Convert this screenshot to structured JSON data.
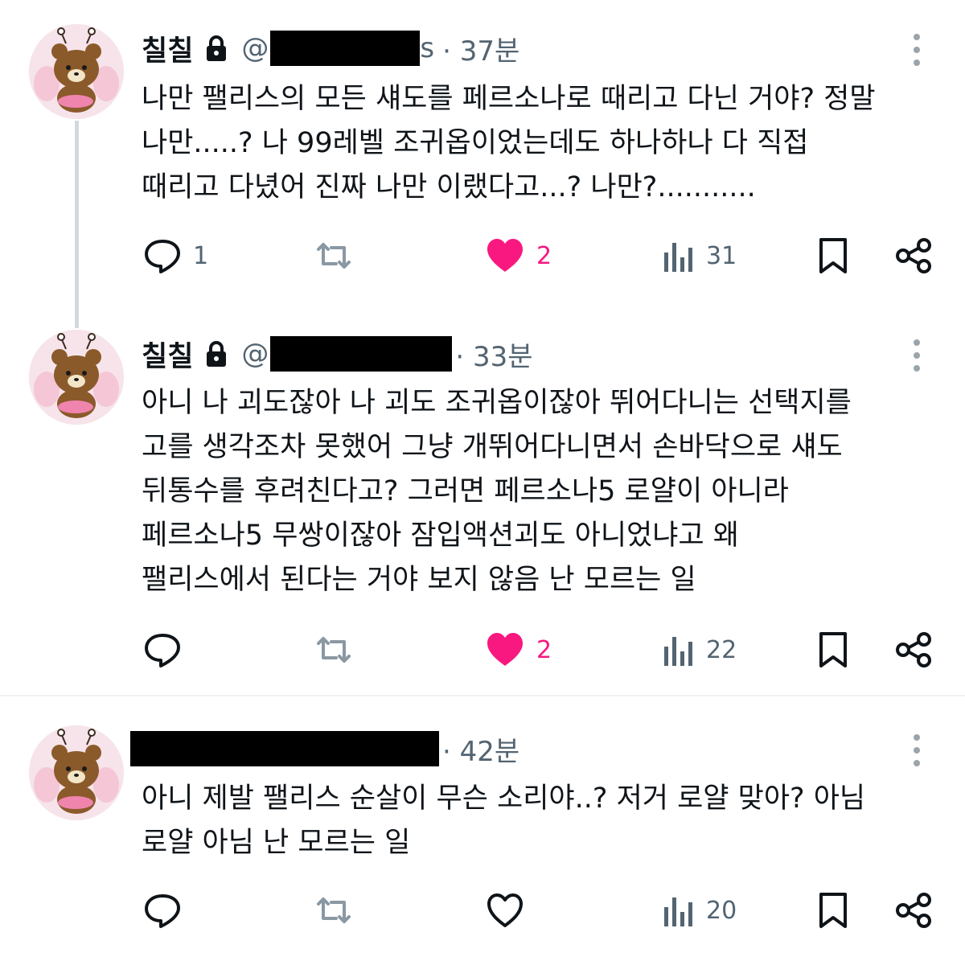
{
  "colors": {
    "like": "#f91880",
    "secondary": "#536471",
    "primary": "#0f1419"
  },
  "tweets": [
    {
      "name": "칠칠",
      "locked": true,
      "handle_prefix": "@",
      "handle_visible_tail": "s",
      "time": "· 37분",
      "lines": [
        "나만 팰리스의 모든 섀도를 페르소나로 때리고 다닌 거야? 정말",
        "나만.....? 나 99레벨 조귀옵이었는데도 하나하나 다 직접",
        "때리고 다녔어 진짜 나만 이랬다고...? 나만?..........."
      ],
      "replies": "1",
      "reposts": "",
      "likes": "2",
      "liked": true,
      "views": "31"
    },
    {
      "name": "칠칠",
      "locked": true,
      "handle_prefix": "@",
      "handle_visible_tail": "",
      "time": "· 33분",
      "lines": [
        "아니 나 괴도잖아 나 괴도 조귀옵이잖아 뛰어다니는 선택지를",
        "고를 생각조차 못했어 그냥 개뛰어다니면서 손바닥으로 섀도",
        "뒤통수를 후려친다고? 그러면 페르소나5 로얄이 아니라",
        "페르소나5 무쌍이잖아 잠입액션괴도 아니었냐고 왜",
        "팰리스에서 된다는 거야 보지 않음 난 모르는 일"
      ],
      "replies": "",
      "reposts": "",
      "likes": "2",
      "liked": true,
      "views": "22"
    },
    {
      "name": "",
      "locked": false,
      "handle_prefix": "",
      "handle_visible_tail": "",
      "time": "· 42분",
      "lines": [
        "아니 제발 팰리스 순살이 무슨 소리야..? 저거 로얄 맞아? 아님",
        "로얄 아님 난 모르는 일"
      ],
      "replies": "",
      "reposts": "",
      "likes": "",
      "liked": false,
      "views": "20"
    }
  ]
}
